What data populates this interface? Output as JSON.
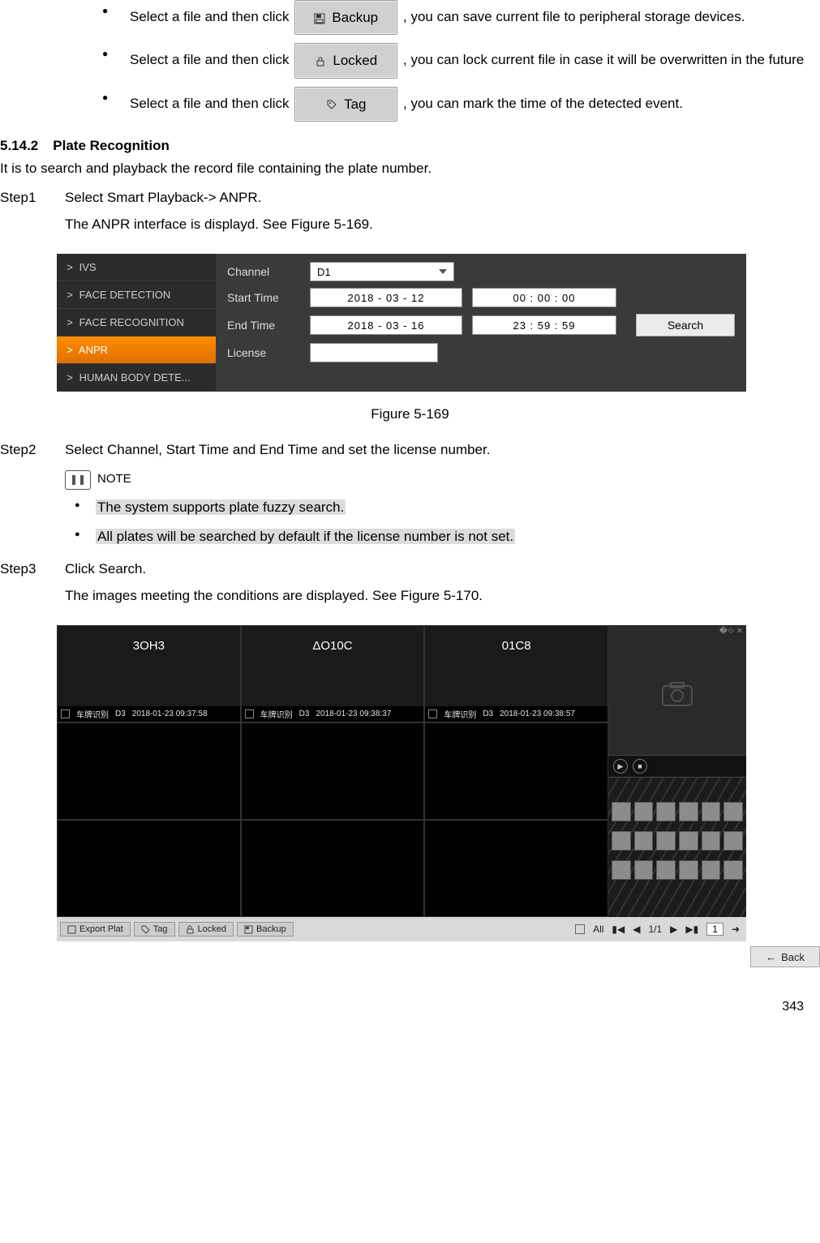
{
  "intro_bullets": {
    "backup": {
      "pre": "Select a file and then click ",
      "btn": "Backup",
      "post": ", you can save current file to peripheral storage devices."
    },
    "locked": {
      "pre": "Select a file and then click ",
      "btn": "Locked",
      "post": ", you can lock current file in case it will be overwritten in the future"
    },
    "tag": {
      "pre": "Select a file and then click ",
      "btn": "Tag",
      "post": ", you can mark the time of the detected event."
    }
  },
  "section": {
    "number": "5.14.2",
    "title": "Plate Recognition"
  },
  "intro_line": "It is to search and playback the record file containing the plate number.",
  "step1": {
    "label": "Step1",
    "line1": "Select Smart Playback-> ANPR.",
    "line2": "The ANPR interface is displayd. See Figure 5-169."
  },
  "fig169": {
    "caption": "Figure 5-169",
    "sidebar": {
      "items": [
        {
          "chev": ">",
          "label": "IVS"
        },
        {
          "chev": ">",
          "label": "FACE DETECTION"
        },
        {
          "chev": ">",
          "label": "FACE RECOGNITION"
        },
        {
          "chev": ">",
          "label": "ANPR",
          "selected": true
        },
        {
          "chev": ">",
          "label": "HUMAN BODY DETE..."
        }
      ]
    },
    "form": {
      "channel_label": "Channel",
      "channel_value": "D1",
      "start_label": "Start Time",
      "start_date": "2018 - 03 - 12",
      "start_time": "00 : 00 : 00",
      "end_label": "End Time",
      "end_date": "2018 - 03 - 16",
      "end_time": "23 : 59 : 59",
      "license_label": "License",
      "license_value": "",
      "search_btn": "Search"
    }
  },
  "step2": {
    "label": "Step2",
    "line": "Select Channel, Start Time and End Time and set the license number.",
    "note_label": "NOTE",
    "notes": [
      "The system supports plate fuzzy search.",
      "All plates will be searched by default if the license number is not set."
    ]
  },
  "step3": {
    "label": "Step3",
    "line1": "Click Search.",
    "line2": "The images meeting the conditions are displayed. See Figure 5-170."
  },
  "fig170": {
    "cells": [
      {
        "plate": "3OH3",
        "meta_label": "车牌识别",
        "ch": "D3",
        "ts": "2018-01-23 09:37:58"
      },
      {
        "plate": "ΔO10C",
        "meta_label": "车牌识别",
        "ch": "D3",
        "ts": "2018-01-23 09:38:37"
      },
      {
        "plate": "01C8",
        "meta_label": "车牌识别",
        "ch": "D3",
        "ts": "2018-01-23 09:38:57"
      }
    ],
    "controls": {
      "play": "▶",
      "stop": "■"
    },
    "bottom_buttons": {
      "export": "Export Plat",
      "tag": "Tag",
      "locked": "Locked",
      "backup": "Backup"
    },
    "all_label": "All",
    "pager": "1/1",
    "pager_page": "1",
    "back": "Back"
  },
  "page_number": "343"
}
